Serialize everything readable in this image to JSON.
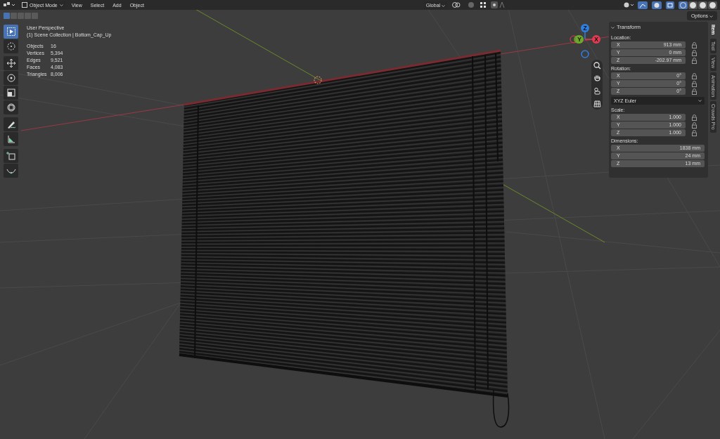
{
  "header": {
    "mode": "Object Mode",
    "menus": [
      {
        "label": "View"
      },
      {
        "label": "Select"
      },
      {
        "label": "Add"
      },
      {
        "label": "Object"
      }
    ],
    "orientation": "Global",
    "options": "Options"
  },
  "select_modes": [
    {
      "selected": true
    },
    {
      "selected": false
    },
    {
      "selected": false
    },
    {
      "selected": false
    },
    {
      "selected": false
    }
  ],
  "shading_modes": [
    {
      "selected": true
    },
    {
      "selected": false
    },
    {
      "selected": false
    },
    {
      "selected": false
    }
  ],
  "tools": [
    {
      "kind": "select",
      "selected": true
    },
    {
      "kind": "cursor",
      "selected": false
    },
    {
      "kind": "move",
      "selected": false
    },
    {
      "kind": "rotate",
      "selected": false
    },
    {
      "kind": "scale",
      "selected": false
    },
    {
      "kind": "transform",
      "selected": false
    },
    {
      "kind": "annotate",
      "selected": false
    },
    {
      "kind": "measure",
      "selected": false
    },
    {
      "kind": "add-cube",
      "selected": false
    },
    {
      "kind": "curve",
      "selected": false
    }
  ],
  "viewport_info": {
    "view": "User Perspective",
    "collection": "(1) Scene Collection | Bottom_Cap_Up",
    "stats": [
      {
        "label": "Objects",
        "value": "16"
      },
      {
        "label": "Vertices",
        "value": "5,394"
      },
      {
        "label": "Edges",
        "value": "9,521"
      },
      {
        "label": "Faces",
        "value": "4,083"
      },
      {
        "label": "Triangles",
        "value": "8,006"
      }
    ]
  },
  "gizmo": {
    "axes": [
      {
        "label": "Z",
        "color": "#2f7fe0"
      },
      {
        "label": "Y",
        "color": "#6fa82a"
      },
      {
        "label": "X",
        "color": "#e23a52"
      }
    ]
  },
  "transform_panel": {
    "title": "Transform",
    "sections": [
      {
        "kind": "vector",
        "label": "Location:",
        "fields": [
          {
            "axis": "X",
            "value": "913 mm",
            "locked": false
          },
          {
            "axis": "Y",
            "value": "0 mm",
            "locked": false
          },
          {
            "axis": "Z",
            "value": "-202.97 mm",
            "locked": false
          }
        ]
      },
      {
        "kind": "vector",
        "label": "Rotation:",
        "fields": [
          {
            "axis": "X",
            "value": "0°",
            "locked": false
          },
          {
            "axis": "Y",
            "value": "0°",
            "locked": false
          },
          {
            "axis": "Z",
            "value": "0°",
            "locked": false
          }
        ]
      },
      {
        "kind": "dropdown",
        "value": "XYZ Euler"
      },
      {
        "kind": "vector",
        "label": "Scale:",
        "fields": [
          {
            "axis": "X",
            "value": "1.000",
            "locked": false
          },
          {
            "axis": "Y",
            "value": "1.000",
            "locked": false
          },
          {
            "axis": "Z",
            "value": "1.000",
            "locked": false
          }
        ]
      },
      {
        "kind": "vector",
        "label": "Dimensions:",
        "fields": [
          {
            "axis": "X",
            "value": "1838 mm"
          },
          {
            "axis": "Y",
            "value": "24 mm"
          },
          {
            "axis": "Z",
            "value": "13 mm"
          }
        ]
      }
    ]
  },
  "side_tabs": [
    {
      "label": "Item",
      "selected": true
    },
    {
      "label": "Tool",
      "selected": false
    },
    {
      "label": "View",
      "selected": false
    },
    {
      "label": "Animation",
      "selected": false
    },
    {
      "label": "Crowds Pro",
      "selected": false
    }
  ]
}
